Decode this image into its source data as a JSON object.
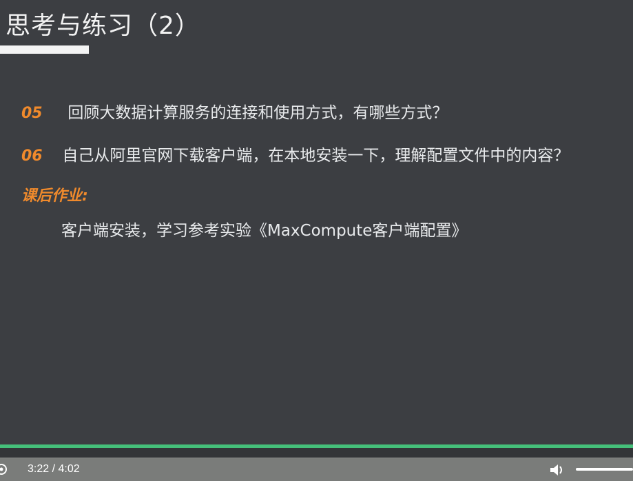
{
  "slide": {
    "title": "思考与练习（2）",
    "questions": [
      {
        "number": "05",
        "text": "回顾大数据计算服务的连接和使用方式，有哪些方式？"
      },
      {
        "number": "06",
        "text": "自己从阿里官网下载客户端，在本地安装一下，理解配置文件中的内容？"
      }
    ],
    "homework_label": "课后作业:",
    "homework_text": "客户端安装，学习参考实验《MaxCompute客户端配置》"
  },
  "player": {
    "current_time": "3:22",
    "separator": "/",
    "duration": "4:02",
    "progress_percent": 100,
    "volume_percent": 100,
    "accent_color": "#45c07a"
  }
}
